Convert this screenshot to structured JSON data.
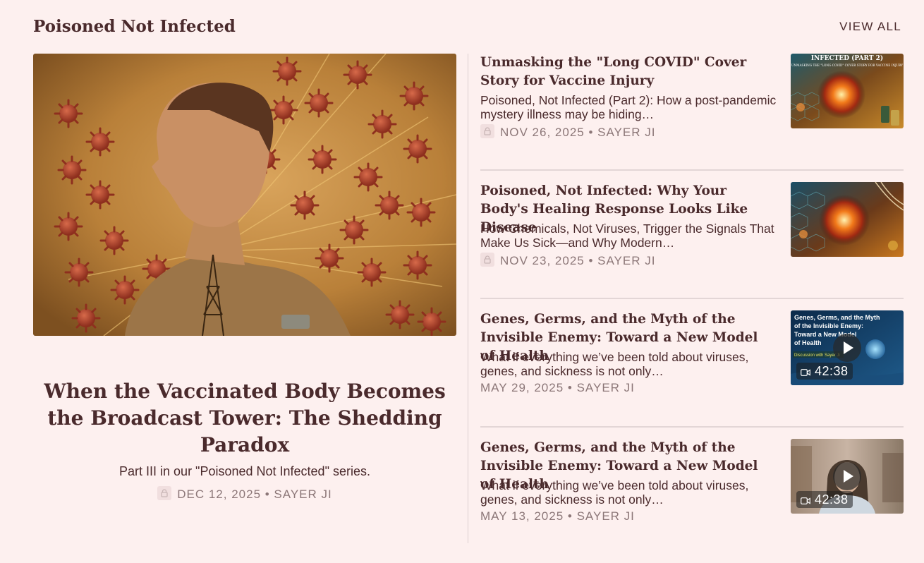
{
  "section": {
    "title": "Poisoned Not Infected",
    "view_all": "VIEW ALL"
  },
  "featured": {
    "title": "When the Vaccinated Body Becomes the Broadcast Tower: The Shedding Paradox",
    "subtitle": "Part III in our \"Poisoned Not Infected\" series.",
    "meta": "DEC 12, 2025 • SAYER JI",
    "image_icon": "man-profile-virus-illustration"
  },
  "posts": [
    {
      "title": "Unmasking the \"Long COVID\" Cover Story for Vaccine Injury",
      "description": "Poisoned, Not Infected (Part 2): How a post-pandemic mystery illness may be hiding…",
      "meta": "NOV 26, 2025 • SAYER JI",
      "locked": true,
      "thumb_caption_1": "INFECTED (PART 2)",
      "thumb_caption_2": "UNMASKING THE \"LONG COVID\" COVER STORY FOR VACCINE INJURY"
    },
    {
      "title": "Poisoned, Not Infected: Why Your Body's Healing Response Looks Like Disease",
      "description": "How Chemicals, Not Viruses, Trigger the Signals That Make Us Sick—and Why Modern…",
      "meta": "NOV 23, 2025 • SAYER JI",
      "locked": true
    },
    {
      "title": "Genes, Germs, and the Myth of the Invisible Enemy: Toward a New Model of Health",
      "description": "What if everything we’ve been told about viruses, genes, and sickness is not only…",
      "meta": "MAY 29, 2025 • SAYER JI",
      "locked": false,
      "duration": "42:38",
      "thumb_caption_1": "Genes, Germs, and the Myth of the Invisible Enemy: Toward a New Model of Health",
      "thumb_caption_2": "Discussion with Sayer Ji"
    },
    {
      "title": "Genes, Germs, and the Myth of the Invisible Enemy: Toward a New Model of Health",
      "description": "What if everything we’ve been told about viruses, genes, and sickness is not only…",
      "meta": "MAY 13, 2025 • SAYER JI",
      "locked": false,
      "duration": "42:38"
    }
  ],
  "colors": {
    "background": "#fdf0ef",
    "text": "#4a2a2c",
    "meta": "#8c7778",
    "divider": "#e3d6d6"
  }
}
